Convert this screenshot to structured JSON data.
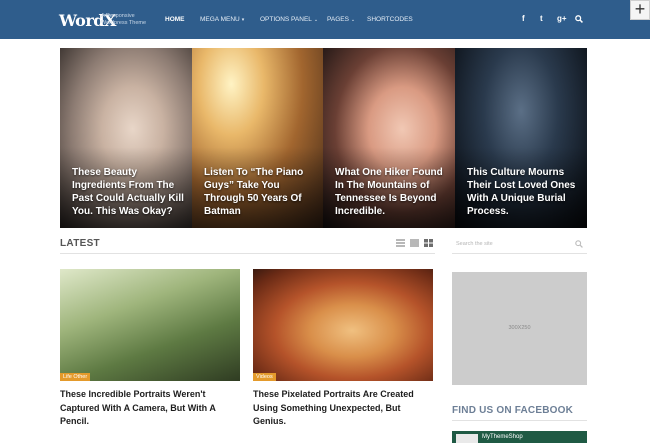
{
  "brand": {
    "logo": "WordX",
    "tagline": "A Responsive Wordpress Theme"
  },
  "nav": [
    {
      "label": "HOME",
      "active": true,
      "dropdown": false
    },
    {
      "label": "MEGA MENU",
      "active": false,
      "dropdown": true
    },
    {
      "label": "OPTIONS PANEL",
      "active": false,
      "dropdown": true
    },
    {
      "label": "PAGES",
      "active": false,
      "dropdown": true
    },
    {
      "label": "SHORTCODES",
      "active": false,
      "dropdown": false
    }
  ],
  "social": {
    "facebook": "f",
    "twitter": "t",
    "googleplus": "g+",
    "search_icon": "search-icon"
  },
  "slides": [
    {
      "title": "These Beauty Ingredients From The Past Could Actually Kill You. This Was Okay?"
    },
    {
      "title": "Listen To “The Piano Guys” Take You Through 50 Years Of Batman"
    },
    {
      "title": "What One Hiker Found In The Mountains of Tennessee Is Beyond Incredible."
    },
    {
      "title": "This Culture Mourns Their Lost Loved Ones With A Unique Burial Process."
    }
  ],
  "latest": {
    "heading": "LATEST"
  },
  "posts": [
    {
      "category": "Life Other",
      "title": "These Incredible Portraits Weren't Captured With A Camera, But With A Pencil."
    },
    {
      "category": "Videos",
      "title": "These Pixelated Portraits Are Created Using Something Unexpected, But Genius."
    }
  ],
  "sidebar": {
    "search_placeholder": "Search the site",
    "ad_label": "300X250",
    "facebook_heading": "FIND US ON FACEBOOK",
    "facebook_page_name": "MyThemeShop"
  },
  "colors": {
    "header": "#2f5d8c",
    "category_badge": "#e49a2b",
    "facebook_box": "#1f5a44"
  }
}
